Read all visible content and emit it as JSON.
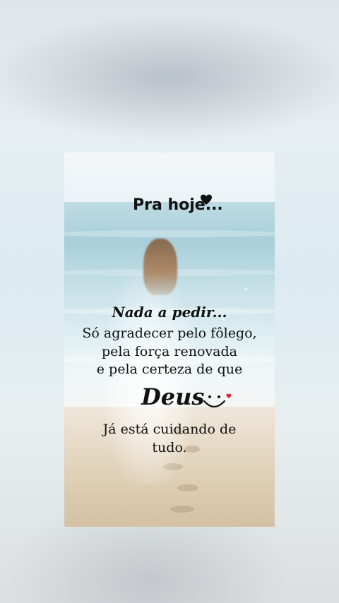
{
  "post": {
    "title": "Pra hoje...",
    "line1": "Nada a pedir...",
    "line2": "Só agradecer pelo fôlego,",
    "line3": "pela força renovada",
    "line4": "e pela certeza de que",
    "highlight_word": "Deus",
    "line5": "Já está cuidando de",
    "line6": "tudo."
  },
  "icons": {
    "title_icon": "heart-icon",
    "emoji": "smiley-heart-icon"
  },
  "colors": {
    "text": "#111111",
    "heart_red": "#d6263a",
    "sea": "#9fcad6",
    "sand": "#d7c3a3"
  }
}
